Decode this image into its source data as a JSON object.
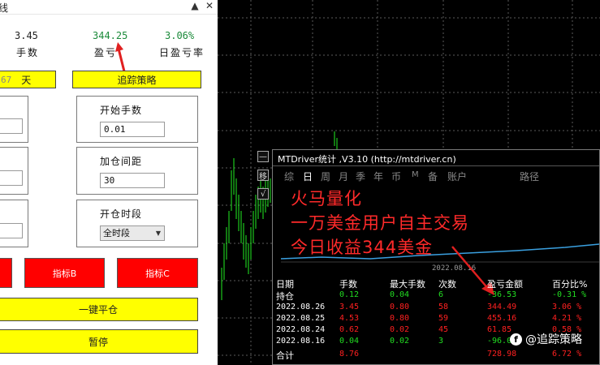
{
  "panel": {
    "title_fragment": "线",
    "stats": [
      {
        "value": "3.45",
        "label": "手数",
        "color": "#222222"
      },
      {
        "value": "344.25",
        "label": "盈亏",
        "color": "#1b8a3a"
      },
      {
        "value": "3.06%",
        "label": "日盈亏率",
        "color": "#1b8a3a"
      }
    ],
    "days_num": "67",
    "days_unit": "天",
    "track_button": "追踪策略",
    "fields": {
      "start_lots": {
        "label": "开始手数",
        "value": "0.01"
      },
      "add_interval": {
        "label": "加仓间距",
        "value": "30"
      },
      "open_period": {
        "label": "开仓时段",
        "value": "全时段"
      }
    },
    "indicator_b": "指标B",
    "indicator_c": "指标C",
    "close_all": "一键平仓",
    "pause": "暂停"
  },
  "stats_window": {
    "title": "MTDriver统计 ,V3.10 (http://mtdriver.cn)",
    "side_buttons": [
      "—",
      "移",
      "√"
    ],
    "tabs": [
      "综",
      "日",
      "周",
      "月",
      "季",
      "年",
      "币",
      "M",
      "备",
      "账户",
      "路径"
    ],
    "active_tab": "日",
    "chart_date": "2022.08.16",
    "overlay": [
      "火马量化",
      "一万美金用户自主交易",
      "今日收益344美金"
    ],
    "columns": [
      "日期",
      "手数",
      "最大手数",
      "次数",
      "盈亏金额",
      "百分比%"
    ],
    "rows": [
      {
        "date": "持仓",
        "lots": "0.12",
        "max": "0.04",
        "count": "6",
        "pnl": "-36.53",
        "pct": "-0.31 %",
        "color": "#22dd22"
      },
      {
        "date": "2022.08.26",
        "lots": "3.45",
        "max": "0.80",
        "count": "58",
        "pnl": "344.49",
        "pct": "3.06 %",
        "color": "#ff2020"
      },
      {
        "date": "2022.08.25",
        "lots": "4.53",
        "max": "0.80",
        "count": "59",
        "pnl": "455.16",
        "pct": "4.21 %",
        "color": "#ff2020"
      },
      {
        "date": "2022.08.24",
        "lots": "0.62",
        "max": "0.02",
        "count": "45",
        "pnl": "61.85",
        "pct": "0.58 %",
        "color": "#ff2020"
      },
      {
        "date": "2022.08.16",
        "lots": "0.04",
        "max": "0.02",
        "count": "3",
        "pnl": "-96.09",
        "pct": "-0.90 %",
        "color": "#22dd22"
      }
    ],
    "total": {
      "date": "合计",
      "lots": "8.76",
      "pnl": "728.98",
      "pct": "6.72 %",
      "color": "#ff2020"
    }
  },
  "watermark": "@追踪策略"
}
